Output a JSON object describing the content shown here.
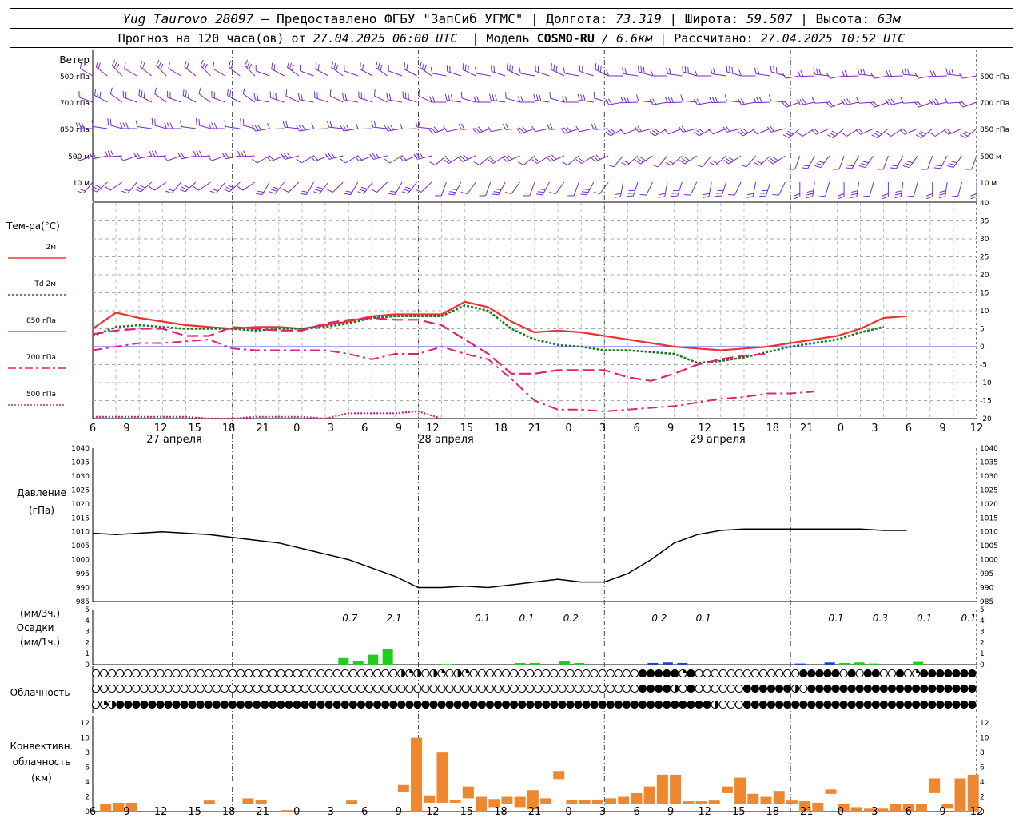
{
  "header": {
    "station": "Yug_Taurovo_28097",
    "provider": "– Предоставлено ФГБУ \"ЗапСиб УГМС\"",
    "lon_label": "Долгота:",
    "lon": "73.319",
    "lat_label": "Широта:",
    "lat": "59.507",
    "alt_label": "Высота:",
    "alt": "63м",
    "forecast_prefix": "Прогноз на 120 часа(ов) от",
    "forecast_time": "27.04.2025 06:00 UTC",
    "model_label": "Модель",
    "model": "COSMO-RU",
    "resolution": "/ 6.6км",
    "calc_label": "Рассчитано:",
    "calc_time": "27.04.2025 10:52 UTC"
  },
  "labels": {
    "wind": "Ветер",
    "wind_levels": [
      "500 гПа",
      "700 гПа",
      "850 гПа",
      "500 м",
      "10 м"
    ],
    "temp": "Тем-ра(°C)",
    "legend": [
      "2м",
      "Td 2м",
      "850 гПа",
      "700 гПа",
      "500 гПа"
    ],
    "pressure": [
      "Давление",
      "(гПа)"
    ],
    "precip": [
      "(мм/3ч.)",
      "Осадки",
      "(мм/1ч.)"
    ],
    "cloud": "Облачность",
    "conv": [
      "Конвективн.",
      "облачность",
      "(км)"
    ]
  },
  "colors": {
    "wind": "#7a28c8",
    "t2m": "#ee3333",
    "td2m": "#1a7a1a",
    "t850": "#e0207a",
    "t700": "#e0207a",
    "t500": "#e0207a",
    "pressure": "#000000",
    "precip_green": "#22cc22",
    "precip_blue": "#2244cc",
    "conv": "#ee8830",
    "zero_line": "#4444ee"
  },
  "chart_data": [
    {
      "type": "line",
      "title": "Тем-ра(°C)",
      "hours_from_start": [
        0,
        3,
        6,
        9,
        12,
        15,
        18,
        21,
        24,
        27,
        30,
        33,
        36,
        39,
        42,
        45,
        48,
        51,
        54,
        57,
        60,
        63,
        66,
        69,
        72,
        75,
        78,
        81,
        84,
        87,
        90,
        93,
        96,
        99,
        102,
        105,
        108,
        111,
        114
      ],
      "ylim": [
        -20,
        40
      ],
      "yticks": [
        -20,
        -15,
        -10,
        -5,
        0,
        5,
        10,
        15,
        20,
        25,
        30,
        35,
        40
      ],
      "series": [
        {
          "name": "2м",
          "values": [
            5,
            9.5,
            8,
            7,
            6,
            5.5,
            5,
            5.5,
            5.5,
            5,
            6,
            7,
            8.5,
            9,
            9,
            9,
            12.5,
            11,
            7,
            4,
            4.5,
            4,
            3,
            2,
            1,
            0,
            -0.5,
            -1,
            -0.5,
            0,
            1,
            2,
            3,
            5,
            8,
            8.5,
            null,
            null,
            null
          ]
        },
        {
          "name": "Td 2м",
          "values": [
            3,
            5.5,
            6,
            5.5,
            5,
            5,
            5,
            4.5,
            5,
            5,
            5.5,
            6.5,
            8,
            8.5,
            8.5,
            8.5,
            11.5,
            10,
            5,
            2,
            0.5,
            0,
            -1,
            -1,
            -1.5,
            -2,
            -4.5,
            -4,
            -3,
            -1.5,
            0,
            1,
            2,
            4,
            5.5,
            null,
            null,
            null,
            null
          ]
        },
        {
          "name": "850 гПа",
          "values": [
            3.5,
            4.5,
            5,
            5,
            3,
            3,
            5.5,
            5,
            4.5,
            4.5,
            6.5,
            7.5,
            8,
            7.5,
            7.5,
            6,
            2,
            -2,
            -7.5,
            -7.5,
            -6.5,
            -6.5,
            -6.5,
            -8.5,
            -9.5,
            -7.5,
            -5,
            -3.5,
            -2.5,
            -2,
            null,
            null,
            null,
            null,
            null,
            null,
            null,
            null,
            null
          ]
        },
        {
          "name": "700 гПа",
          "values": [
            -1,
            0,
            1,
            1,
            1.5,
            2,
            -0.5,
            -1,
            -1,
            -1,
            -1,
            -2,
            -3.5,
            -2,
            -2,
            0,
            -2,
            -3.5,
            -9,
            -15,
            -17.5,
            -17.5,
            -18,
            -17.5,
            -17,
            -16.5,
            -15.5,
            -14.5,
            -14,
            -13,
            -13,
            -12.5,
            null,
            null,
            null,
            null,
            null,
            null,
            null
          ]
        },
        {
          "name": "500 гПа",
          "values": [
            -19.5,
            -19.5,
            -19.5,
            -19.5,
            -19.5,
            -20,
            -20,
            -19.5,
            -19.5,
            -19.5,
            -20,
            -18.5,
            -18.5,
            -18.5,
            -18,
            -20,
            null,
            null,
            null,
            null,
            null,
            null,
            null,
            null,
            null,
            null,
            null,
            null,
            null,
            null,
            null,
            null,
            null,
            null,
            null,
            null,
            null,
            null,
            null
          ]
        }
      ]
    },
    {
      "type": "line",
      "title": "Давление (гПа)",
      "ylim": [
        985,
        1040
      ],
      "yticks": [
        985,
        990,
        995,
        1000,
        1005,
        1010,
        1015,
        1020,
        1025,
        1030,
        1035,
        1040
      ],
      "hours_from_start": [
        0,
        3,
        6,
        9,
        12,
        15,
        18,
        21,
        24,
        27,
        30,
        33,
        36,
        39,
        42,
        45,
        48,
        51,
        54,
        57,
        60,
        63,
        66,
        69,
        72,
        75,
        78,
        81,
        84,
        87,
        90,
        93,
        96,
        99,
        102,
        105,
        108,
        111,
        114
      ],
      "series": [
        {
          "name": "Давление",
          "values": [
            1009.5,
            1009,
            1009.5,
            1010,
            1009.5,
            1009,
            1008,
            1007,
            1006,
            1004,
            1002,
            1000,
            997,
            994,
            990,
            990,
            990.5,
            990,
            991,
            992,
            993,
            992,
            992,
            995,
            1000,
            1006,
            1009,
            1010.5,
            1011,
            1011,
            1011,
            1011,
            1011,
            1011,
            1010.5,
            1010.5,
            null,
            null,
            null
          ]
        }
      ]
    },
    {
      "type": "bar",
      "title": "Осадки",
      "ylim": [
        0,
        5
      ],
      "yticks": [
        0,
        1,
        2,
        3,
        4,
        5
      ],
      "totals": [
        {
          "hour": 18,
          "value": "0.7"
        },
        {
          "hour": 21,
          "value": "2.1"
        },
        {
          "hour": 27,
          "value": "0.1"
        },
        {
          "hour": 30,
          "value": "0.1"
        },
        {
          "hour": 33,
          "value": "0.2"
        },
        {
          "hour": 39,
          "value": "0.2"
        },
        {
          "hour": 42,
          "value": "0.1"
        },
        {
          "hour": 51,
          "value": "0.1"
        },
        {
          "hour": 54,
          "value": "0.3"
        },
        {
          "hour": 57,
          "value": "0.1"
        },
        {
          "hour": 60,
          "value": "0.1"
        }
      ],
      "bars": [
        {
          "h": 17,
          "v": 0.6,
          "c": "g"
        },
        {
          "h": 18,
          "v": 0.3,
          "c": "g"
        },
        {
          "h": 19,
          "v": 0.9,
          "c": "g"
        },
        {
          "h": 20,
          "v": 1.4,
          "c": "g"
        },
        {
          "h": 24,
          "v": 0.05,
          "c": "g"
        },
        {
          "h": 29,
          "v": 0.15,
          "c": "g"
        },
        {
          "h": 30,
          "v": 0.15,
          "c": "g"
        },
        {
          "h": 32,
          "v": 0.3,
          "c": "g"
        },
        {
          "h": 33,
          "v": 0.15,
          "c": "g"
        },
        {
          "h": 38,
          "v": 0.15,
          "c": "b"
        },
        {
          "h": 39,
          "v": 0.2,
          "c": "b"
        },
        {
          "h": 40,
          "v": 0.15,
          "c": "b"
        },
        {
          "h": 48,
          "v": 0.1,
          "c": "b"
        },
        {
          "h": 50,
          "v": 0.2,
          "c": "b"
        },
        {
          "h": 51,
          "v": 0.15,
          "c": "g"
        },
        {
          "h": 52,
          "v": 0.2,
          "c": "g"
        },
        {
          "h": 53,
          "v": 0.1,
          "c": "g"
        },
        {
          "h": 56,
          "v": 0.25,
          "c": "g"
        }
      ]
    },
    {
      "type": "bar",
      "title": "Конвективн. облачность (км)",
      "ylim": [
        0,
        13
      ],
      "yticks": [
        0,
        2,
        4,
        6,
        8,
        10,
        12
      ],
      "bars": [
        {
          "h": 1,
          "lo": 0,
          "hi": 1
        },
        {
          "h": 2,
          "lo": 0,
          "hi": 1.2
        },
        {
          "h": 3,
          "lo": 0,
          "hi": 1.2
        },
        {
          "h": 9,
          "lo": 1,
          "hi": 1.5
        },
        {
          "h": 12,
          "lo": 1,
          "hi": 1.8
        },
        {
          "h": 13,
          "lo": 1,
          "hi": 1.6
        },
        {
          "h": 15,
          "lo": 0,
          "hi": 0.2
        },
        {
          "h": 20,
          "lo": 1,
          "hi": 1.5
        },
        {
          "h": 24,
          "lo": 2.6,
          "hi": 3.6
        },
        {
          "h": 25,
          "lo": 0,
          "hi": 10
        },
        {
          "h": 26,
          "lo": 1.2,
          "hi": 2.2
        },
        {
          "h": 27,
          "lo": 1.2,
          "hi": 8
        },
        {
          "h": 28,
          "lo": 1.2,
          "hi": 1.6
        },
        {
          "h": 29,
          "lo": 1.8,
          "hi": 3.4
        },
        {
          "h": 30,
          "lo": 0,
          "hi": 2
        },
        {
          "h": 31,
          "lo": 0.6,
          "hi": 1.7
        },
        {
          "h": 32,
          "lo": 1,
          "hi": 2
        },
        {
          "h": 33,
          "lo": 0.6,
          "hi": 2
        },
        {
          "h": 34,
          "lo": 0.3,
          "hi": 2.9
        },
        {
          "h": 35,
          "lo": 1,
          "hi": 1.8
        },
        {
          "h": 36,
          "lo": 4.4,
          "hi": 5.5
        },
        {
          "h": 37,
          "lo": 1,
          "hi": 1.6
        },
        {
          "h": 38,
          "lo": 1,
          "hi": 1.6
        },
        {
          "h": 39,
          "lo": 1,
          "hi": 1.6
        },
        {
          "h": 40,
          "lo": 1,
          "hi": 1.8
        },
        {
          "h": 41,
          "lo": 1,
          "hi": 2
        },
        {
          "h": 42,
          "lo": 1,
          "hi": 2.5
        },
        {
          "h": 43,
          "lo": 1,
          "hi": 3.4
        },
        {
          "h": 44,
          "lo": 1,
          "hi": 5
        },
        {
          "h": 45,
          "lo": 1,
          "hi": 5
        },
        {
          "h": 46,
          "lo": 1,
          "hi": 1.4
        },
        {
          "h": 47,
          "lo": 1,
          "hi": 1.4
        },
        {
          "h": 48,
          "lo": 1,
          "hi": 1.5
        },
        {
          "h": 49,
          "lo": 2.5,
          "hi": 3.4
        },
        {
          "h": 50,
          "lo": 1,
          "hi": 4.6
        },
        {
          "h": 51,
          "lo": 1,
          "hi": 2.4
        },
        {
          "h": 52,
          "lo": 1,
          "hi": 2
        },
        {
          "h": 53,
          "lo": 1,
          "hi": 2.8
        },
        {
          "h": 54,
          "lo": 1,
          "hi": 1.5
        },
        {
          "h": 55,
          "lo": 0,
          "hi": 1.4
        },
        {
          "h": 56,
          "lo": 0,
          "hi": 1.2
        },
        {
          "h": 57,
          "lo": 2.4,
          "hi": 3
        },
        {
          "h": 58,
          "lo": 0,
          "hi": 1
        },
        {
          "h": 59,
          "lo": 0,
          "hi": 0.6
        },
        {
          "h": 60,
          "lo": 0,
          "hi": 0.4
        },
        {
          "h": 61,
          "lo": 0,
          "hi": 0.4
        },
        {
          "h": 62,
          "lo": 0,
          "hi": 1
        },
        {
          "h": 63,
          "lo": 0,
          "hi": 1
        },
        {
          "h": 64,
          "lo": 0,
          "hi": 1
        },
        {
          "h": 65,
          "lo": 2.5,
          "hi": 4.5
        },
        {
          "h": 66,
          "lo": 0.4,
          "hi": 1
        },
        {
          "h": 67,
          "lo": 0,
          "hi": 4.5
        },
        {
          "h": 68,
          "lo": 0,
          "hi": 5
        }
      ]
    }
  ],
  "x_axis": {
    "hour_labels": [
      "6",
      "9",
      "12",
      "15",
      "18",
      "21",
      "0",
      "3",
      "6",
      "9",
      "12",
      "15",
      "18",
      "21",
      "0",
      "3",
      "6",
      "9",
      "12",
      "15",
      "18",
      "21",
      "0",
      "3",
      "6",
      "9",
      "12"
    ],
    "dates": [
      "27 апреля",
      "28 апреля",
      "29 апреля"
    ]
  },
  "cloud_rows": {
    "top": "OOOOOOOOOOOOOOOOOOOOOOOOOOOOOOOOOOOOqqOpqpqOpOOOOOOOOOOOOOOOOOOOOOOOOOOOOOOOOOOOOOOOOOOOOOOOOOOOOOOOOOOOOOOOOOOOOOOOOOOOOOOOOOOOOOOOOOOOOOpOOOOOOOOOOOO",
    "mid": "OOOOOOOOOOOOOOOOOOOOOOOOOOOOOOOOOOOOOOOOOOOOOOOOOOOOOOOOOOOOOOOOOOOOOOOOOOOOOOOOOOOOOOOOOOOOOOOOOOOOOOOOOOOOOOOOOOOOOOOOOOOOOOOOOOOOOOOOOOOOOOOO",
    "low": "OOOOOOOOOOOOOOOOOOOOOOOOOOOOOOOOOOOOOOOOOOOOOOOOOOOOOOOOOOOOOOOOOOOOOOOOOOOOOOOOOOOOOOOOOOOOOOOOOOOOOOOOOOOOOOOOOOOOOOOOOOOOOOOOOOOOOOOOOOOOOOOOO"
  }
}
